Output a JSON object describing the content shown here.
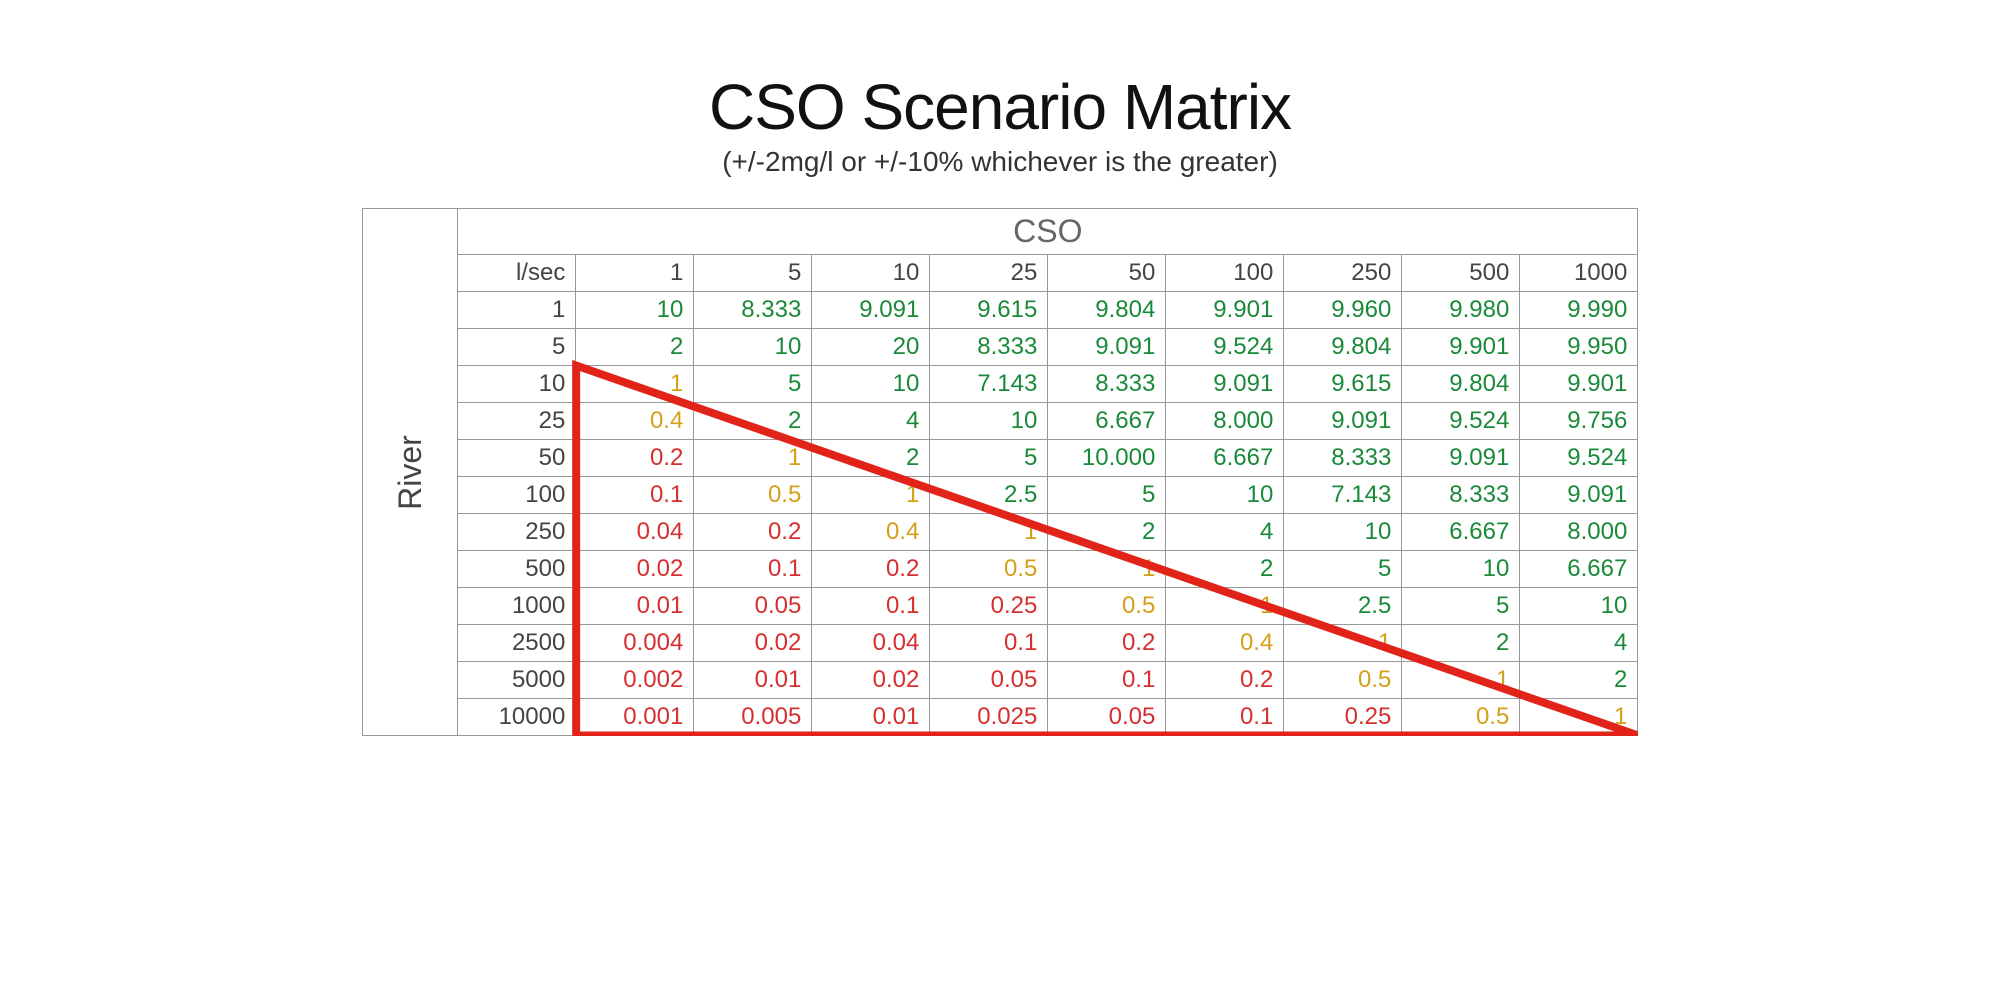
{
  "title": "CSO Scenario Matrix",
  "subtitle": "(+/-2mg/l or +/-10% whichever is the greater)",
  "axis_top": "CSO",
  "axis_left": "River",
  "unit_label": "l/sec",
  "cso_cols": [
    "1",
    "5",
    "10",
    "25",
    "50",
    "100",
    "250",
    "500",
    "1000"
  ],
  "river_rows": [
    "1",
    "5",
    "10",
    "25",
    "50",
    "100",
    "250",
    "500",
    "1000",
    "2500",
    "5000",
    "10000"
  ],
  "cells": [
    [
      {
        "v": "10",
        "c": "g"
      },
      {
        "v": "8.333",
        "c": "g"
      },
      {
        "v": "9.091",
        "c": "g"
      },
      {
        "v": "9.615",
        "c": "g"
      },
      {
        "v": "9.804",
        "c": "g"
      },
      {
        "v": "9.901",
        "c": "g"
      },
      {
        "v": "9.960",
        "c": "g"
      },
      {
        "v": "9.980",
        "c": "g"
      },
      {
        "v": "9.990",
        "c": "g"
      }
    ],
    [
      {
        "v": "2",
        "c": "g"
      },
      {
        "v": "10",
        "c": "g"
      },
      {
        "v": "20",
        "c": "g"
      },
      {
        "v": "8.333",
        "c": "g"
      },
      {
        "v": "9.091",
        "c": "g"
      },
      {
        "v": "9.524",
        "c": "g"
      },
      {
        "v": "9.804",
        "c": "g"
      },
      {
        "v": "9.901",
        "c": "g"
      },
      {
        "v": "9.950",
        "c": "g"
      }
    ],
    [
      {
        "v": "1",
        "c": "o"
      },
      {
        "v": "5",
        "c": "g"
      },
      {
        "v": "10",
        "c": "g"
      },
      {
        "v": "7.143",
        "c": "g"
      },
      {
        "v": "8.333",
        "c": "g"
      },
      {
        "v": "9.091",
        "c": "g"
      },
      {
        "v": "9.615",
        "c": "g"
      },
      {
        "v": "9.804",
        "c": "g"
      },
      {
        "v": "9.901",
        "c": "g"
      }
    ],
    [
      {
        "v": "0.4",
        "c": "o"
      },
      {
        "v": "2",
        "c": "g"
      },
      {
        "v": "4",
        "c": "g"
      },
      {
        "v": "10",
        "c": "g"
      },
      {
        "v": "6.667",
        "c": "g"
      },
      {
        "v": "8.000",
        "c": "g"
      },
      {
        "v": "9.091",
        "c": "g"
      },
      {
        "v": "9.524",
        "c": "g"
      },
      {
        "v": "9.756",
        "c": "g"
      }
    ],
    [
      {
        "v": "0.2",
        "c": "r"
      },
      {
        "v": "1",
        "c": "o"
      },
      {
        "v": "2",
        "c": "g"
      },
      {
        "v": "5",
        "c": "g"
      },
      {
        "v": "10.000",
        "c": "g"
      },
      {
        "v": "6.667",
        "c": "g"
      },
      {
        "v": "8.333",
        "c": "g"
      },
      {
        "v": "9.091",
        "c": "g"
      },
      {
        "v": "9.524",
        "c": "g"
      }
    ],
    [
      {
        "v": "0.1",
        "c": "r"
      },
      {
        "v": "0.5",
        "c": "o"
      },
      {
        "v": "1",
        "c": "o"
      },
      {
        "v": "2.5",
        "c": "g"
      },
      {
        "v": "5",
        "c": "g"
      },
      {
        "v": "10",
        "c": "g"
      },
      {
        "v": "7.143",
        "c": "g"
      },
      {
        "v": "8.333",
        "c": "g"
      },
      {
        "v": "9.091",
        "c": "g"
      }
    ],
    [
      {
        "v": "0.04",
        "c": "r"
      },
      {
        "v": "0.2",
        "c": "r"
      },
      {
        "v": "0.4",
        "c": "o"
      },
      {
        "v": "1",
        "c": "o"
      },
      {
        "v": "2",
        "c": "g"
      },
      {
        "v": "4",
        "c": "g"
      },
      {
        "v": "10",
        "c": "g"
      },
      {
        "v": "6.667",
        "c": "g"
      },
      {
        "v": "8.000",
        "c": "g"
      }
    ],
    [
      {
        "v": "0.02",
        "c": "r"
      },
      {
        "v": "0.1",
        "c": "r"
      },
      {
        "v": "0.2",
        "c": "r"
      },
      {
        "v": "0.5",
        "c": "o"
      },
      {
        "v": "1",
        "c": "o"
      },
      {
        "v": "2",
        "c": "g"
      },
      {
        "v": "5",
        "c": "g"
      },
      {
        "v": "10",
        "c": "g"
      },
      {
        "v": "6.667",
        "c": "g"
      }
    ],
    [
      {
        "v": "0.01",
        "c": "r"
      },
      {
        "v": "0.05",
        "c": "r"
      },
      {
        "v": "0.1",
        "c": "r"
      },
      {
        "v": "0.25",
        "c": "r"
      },
      {
        "v": "0.5",
        "c": "o"
      },
      {
        "v": "1",
        "c": "o"
      },
      {
        "v": "2.5",
        "c": "g"
      },
      {
        "v": "5",
        "c": "g"
      },
      {
        "v": "10",
        "c": "g"
      }
    ],
    [
      {
        "v": "0.004",
        "c": "r"
      },
      {
        "v": "0.02",
        "c": "r"
      },
      {
        "v": "0.04",
        "c": "r"
      },
      {
        "v": "0.1",
        "c": "r"
      },
      {
        "v": "0.2",
        "c": "r"
      },
      {
        "v": "0.4",
        "c": "o"
      },
      {
        "v": "1",
        "c": "o"
      },
      {
        "v": "2",
        "c": "g"
      },
      {
        "v": "4",
        "c": "g"
      }
    ],
    [
      {
        "v": "0.002",
        "c": "r"
      },
      {
        "v": "0.01",
        "c": "r"
      },
      {
        "v": "0.02",
        "c": "r"
      },
      {
        "v": "0.05",
        "c": "r"
      },
      {
        "v": "0.1",
        "c": "r"
      },
      {
        "v": "0.2",
        "c": "r"
      },
      {
        "v": "0.5",
        "c": "o"
      },
      {
        "v": "1",
        "c": "o"
      },
      {
        "v": "2",
        "c": "g"
      }
    ],
    [
      {
        "v": "0.001",
        "c": "r"
      },
      {
        "v": "0.005",
        "c": "r"
      },
      {
        "v": "0.01",
        "c": "r"
      },
      {
        "v": "0.025",
        "c": "r"
      },
      {
        "v": "0.05",
        "c": "r"
      },
      {
        "v": "0.1",
        "c": "r"
      },
      {
        "v": "0.25",
        "c": "r"
      },
      {
        "v": "0.5",
        "c": "o"
      },
      {
        "v": "1",
        "c": "o"
      }
    ]
  ],
  "chart_data": {
    "type": "table",
    "title": "CSO Scenario Matrix",
    "subtitle": "+/-2mg/l or +/-10% whichever is the greater",
    "xlabel": "CSO (l/sec)",
    "ylabel": "River (l/sec)",
    "x": [
      1,
      5,
      10,
      25,
      50,
      100,
      250,
      500,
      1000
    ],
    "y": [
      1,
      5,
      10,
      25,
      50,
      100,
      250,
      500,
      1000,
      2500,
      5000,
      10000
    ],
    "values": [
      [
        10,
        8.333,
        9.091,
        9.615,
        9.804,
        9.901,
        9.96,
        9.98,
        9.99
      ],
      [
        2,
        10,
        20,
        8.333,
        9.091,
        9.524,
        9.804,
        9.901,
        9.95
      ],
      [
        1,
        5,
        10,
        7.143,
        8.333,
        9.091,
        9.615,
        9.804,
        9.901
      ],
      [
        0.4,
        2,
        4,
        10,
        6.667,
        8.0,
        9.091,
        9.524,
        9.756
      ],
      [
        0.2,
        1,
        2,
        5,
        10.0,
        6.667,
        8.333,
        9.091,
        9.524
      ],
      [
        0.1,
        0.5,
        1,
        2.5,
        5,
        10,
        7.143,
        8.333,
        9.091
      ],
      [
        0.04,
        0.2,
        0.4,
        1,
        2,
        4,
        10,
        6.667,
        8.0
      ],
      [
        0.02,
        0.1,
        0.2,
        0.5,
        1,
        2,
        5,
        10,
        6.667
      ],
      [
        0.01,
        0.05,
        0.1,
        0.25,
        0.5,
        1,
        2.5,
        5,
        10
      ],
      [
        0.004,
        0.02,
        0.04,
        0.1,
        0.2,
        0.4,
        1,
        2,
        4
      ],
      [
        0.002,
        0.01,
        0.02,
        0.05,
        0.1,
        0.2,
        0.5,
        1,
        2
      ],
      [
        0.001,
        0.005,
        0.01,
        0.025,
        0.05,
        0.1,
        0.25,
        0.5,
        1
      ]
    ],
    "color_legend": {
      "green": ">=2",
      "orange": ">=0.4 and <2",
      "red": "<0.4"
    },
    "highlight_shape": "lower-left triangle (River >= CSO*10 region)"
  }
}
